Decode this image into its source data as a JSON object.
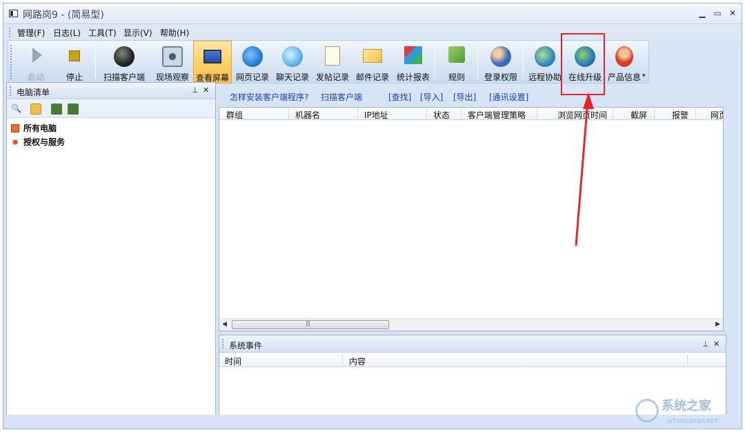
{
  "window": {
    "title": "网路岗9 - (简易型)"
  },
  "menu": [
    "管理(F)",
    "日志(L)",
    "工具(T)",
    "显示(V)",
    "帮助(H)"
  ],
  "toolbar": [
    {
      "label": "启动",
      "icon": "play-icon",
      "state": "disabled"
    },
    {
      "label": "停止",
      "icon": "stop-icon",
      "state": "normal"
    },
    {
      "label": "扫描客户端",
      "icon": "scan-camera-icon",
      "state": "normal"
    },
    {
      "label": "现场观察",
      "icon": "eye-icon",
      "state": "normal"
    },
    {
      "label": "查看屏幕",
      "icon": "screen-icon",
      "state": "active"
    },
    {
      "label": "网页记录",
      "icon": "ie-icon",
      "state": "normal"
    },
    {
      "label": "聊天记录",
      "icon": "chat-bubble-icon",
      "state": "normal"
    },
    {
      "label": "发帖记录",
      "icon": "post-pencil-icon",
      "state": "normal"
    },
    {
      "label": "邮件记录",
      "icon": "envelope-icon",
      "state": "normal"
    },
    {
      "label": "统计报表",
      "icon": "cubes-icon",
      "state": "normal"
    },
    {
      "label": "规则",
      "icon": "rules-icon",
      "state": "normal"
    },
    {
      "label": "登录权限",
      "icon": "users-icon",
      "state": "normal"
    },
    {
      "label": "远程协助",
      "icon": "remote-globe-icon",
      "state": "normal"
    },
    {
      "label": "在线升级",
      "icon": "globe-arrow-icon",
      "state": "normal"
    },
    {
      "label": "产品信息",
      "icon": "mascot-icon",
      "state": "normal"
    }
  ],
  "left_panel": {
    "title": "电脑清单",
    "tree": [
      {
        "label": "所有电脑",
        "icon": "computer-group-icon"
      },
      {
        "label": "授权与服务",
        "icon": "service-icon"
      }
    ]
  },
  "links": [
    "怎样安装客户端程序?",
    "扫描客户端",
    "[查找]",
    "[导入]",
    "[导出]",
    "[通讯设置]"
  ],
  "table": {
    "columns": [
      "群组",
      "机器名",
      "IP地址",
      "状态",
      "客户端管理策略",
      "浏览网页时间",
      "截屏",
      "报警",
      "网页粘贴"
    ]
  },
  "events": {
    "title": "系统事件",
    "columns": [
      "时间",
      "内容"
    ]
  },
  "watermark": {
    "main": "系统之家",
    "sub": "XITONGZHIJIA.NET"
  },
  "colors": {
    "highlight": "#e8232a",
    "link": "#1a3fbf",
    "active_button": "#fbd26a"
  }
}
